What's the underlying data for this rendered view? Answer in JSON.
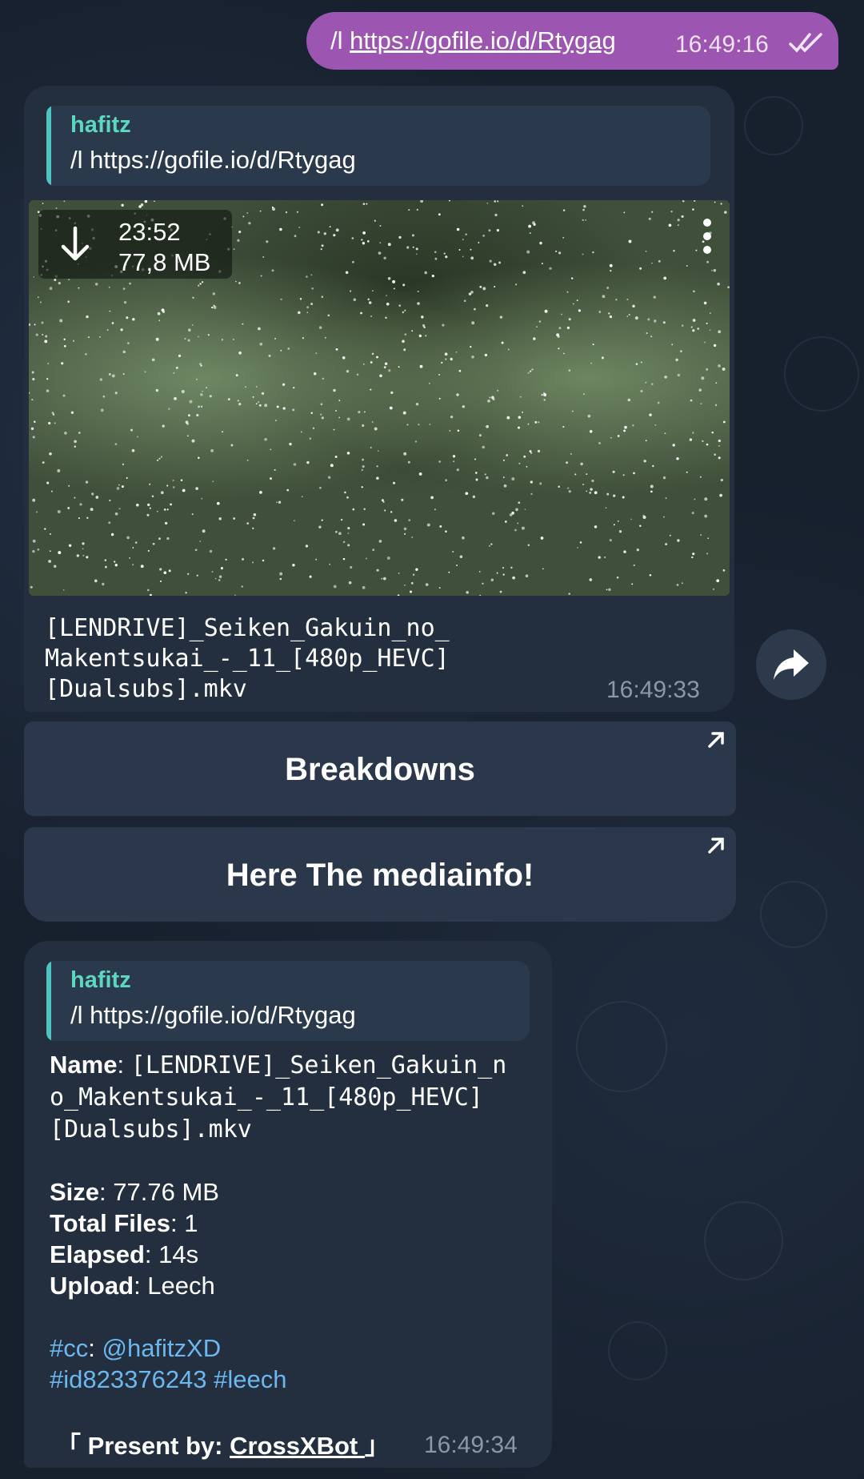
{
  "outgoing": {
    "command": "/l",
    "link": "https://gofile.io/d/Rtygag",
    "time": "16:49:16"
  },
  "message1": {
    "reply_name": "hafitz",
    "reply_text": "/l https://gofile.io/d/Rtygag",
    "video_duration": "23:52",
    "video_size": "77,8 MB",
    "caption": "[LENDRIVE]_Seiken_Gakuin_no_\nMakentsukai_-_11_[480p_HEVC]\n[Dualsubs].mkv",
    "time": "16:49:33"
  },
  "buttons": {
    "breakdowns": "Breakdowns",
    "mediainfo": "Here The mediainfo!"
  },
  "message2": {
    "reply_name": "hafitz",
    "reply_text": "/l https://gofile.io/d/Rtygag",
    "name_label": "Name",
    "name_value": "[LENDRIVE]_Seiken_Gakuin_n\no_Makentsukai_-_11_[480p_HEVC]\n[Dualsubs].mkv",
    "size_label": "Size",
    "size_value": "77.76 MB",
    "files_label": "Total Files",
    "files_value": "1",
    "elapsed_label": "Elapsed",
    "elapsed_value": "14s",
    "upload_label": "Upload",
    "upload_value": "Leech",
    "cc_tag": "#cc",
    "cc_user": "@hafitzXD",
    "id_tag": "#id823376243",
    "leech_tag": "#leech",
    "present_open": "「 Present by: ",
    "present_bot": "CrossXBot ",
    "present_close": "」",
    "time": "16:49:34"
  },
  "colors": {
    "outgoing_bubble": "#9c55b0",
    "incoming_bubble": "#232f3f",
    "reply_accent": "#4fc3c0",
    "link_blue": "#6bb7ee"
  },
  "icons": [
    "double-check-icon",
    "download-arrow-icon",
    "more-vertical-icon",
    "share-icon",
    "open-link-icon"
  ]
}
